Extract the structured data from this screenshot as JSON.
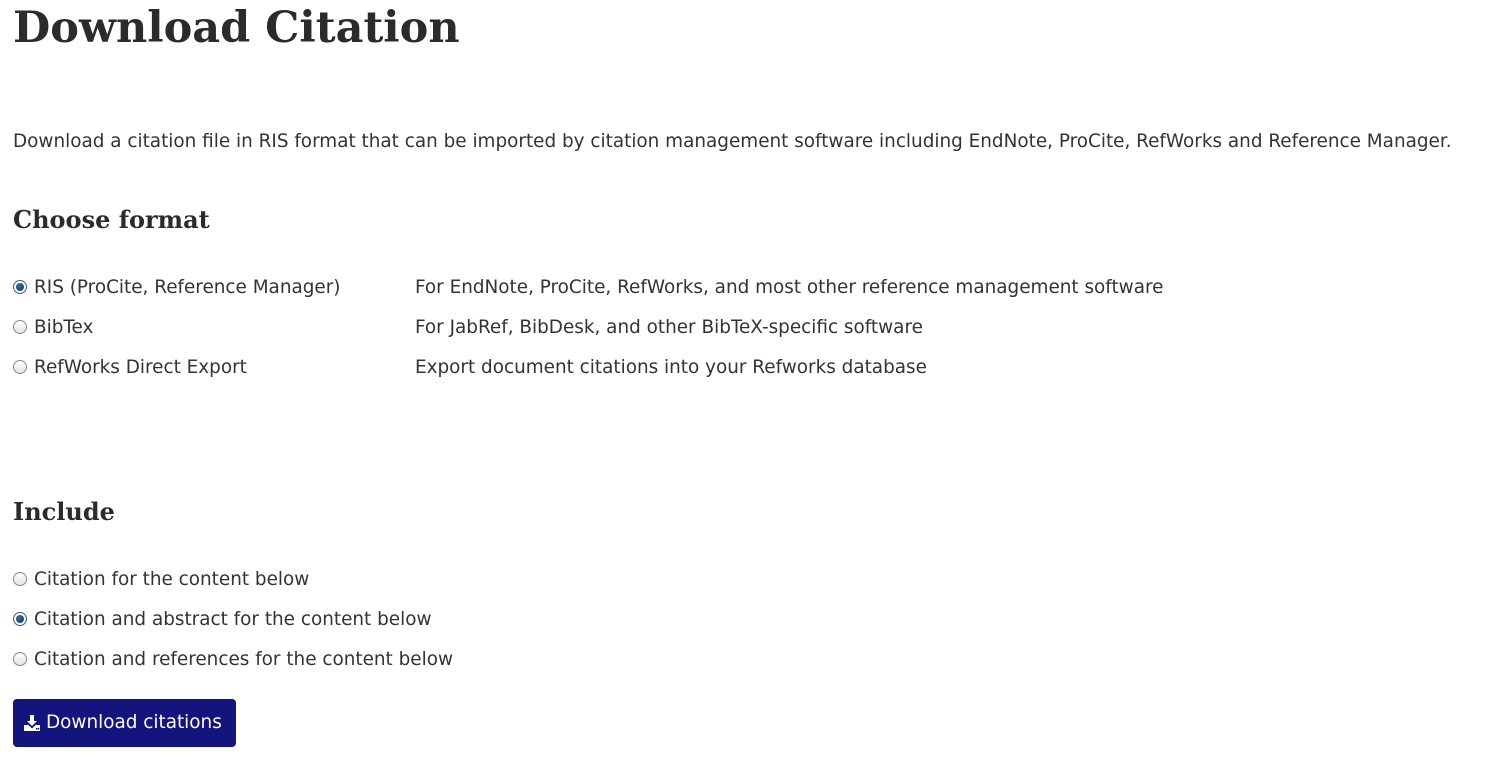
{
  "page": {
    "title": "Download Citation",
    "intro": "Download a citation file in RIS format that can be imported by citation management software including EndNote, ProCite, RefWorks and Reference Manager."
  },
  "format": {
    "heading": "Choose format",
    "options": [
      {
        "label": "RIS (ProCite, Reference Manager)",
        "description": "For EndNote, ProCite, RefWorks, and most other reference management software",
        "selected": true
      },
      {
        "label": "BibTex",
        "description": "For JabRef, BibDesk, and other BibTeX-specific software",
        "selected": false
      },
      {
        "label": "RefWorks Direct Export",
        "description": "Export document citations into your Refworks database",
        "selected": false
      }
    ]
  },
  "include": {
    "heading": "Include",
    "options": [
      {
        "label": "Citation for the content below",
        "selected": false
      },
      {
        "label": "Citation and abstract for the content below",
        "selected": true
      },
      {
        "label": "Citation and references for the content below",
        "selected": false
      }
    ]
  },
  "actions": {
    "download_label": "Download citations",
    "download_icon": "download-icon"
  },
  "colors": {
    "button_bg": "#13147c",
    "text": "#333333",
    "radio_checked": "#1f4a7d"
  }
}
